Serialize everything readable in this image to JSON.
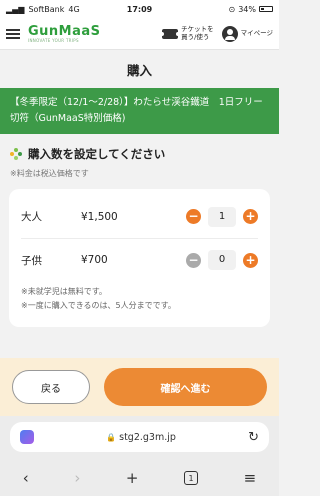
{
  "status_bar": {
    "carrier": "SoftBank",
    "network": "4G",
    "time": "17:09",
    "battery": "34%"
  },
  "header": {
    "logo_name": "GunMaaS",
    "logo_tagline": "INNOVATE YOUR TRIPS",
    "ticket_line1": "チケットを",
    "ticket_line2": "買う/使う",
    "mypage_label": "マイページ"
  },
  "page": {
    "title": "購入"
  },
  "banner": {
    "text": "【冬季限定（12/1〜2/28）】わたらせ渓谷鐵道　1日フリー切符（GunMaaS特別価格)"
  },
  "section": {
    "heading": "購入数を設定してください",
    "tax_note": "※料金は税込価格です"
  },
  "tickets": [
    {
      "label": "大人",
      "price": "¥1,500",
      "quantity": "1",
      "minus_enabled": true
    },
    {
      "label": "子供",
      "price": "¥700",
      "quantity": "0",
      "minus_enabled": false
    }
  ],
  "notes": [
    "※未就学児は無料です。",
    "※一度に購入できるのは、5人分までです。"
  ],
  "footer": {
    "back_label": "戻る",
    "confirm_label": "確認へ進む"
  },
  "browser": {
    "url": "stg2.g3m.jp",
    "tab_count": "1"
  },
  "colors": {
    "brand_green": "#3d9a48",
    "accent_orange": "#ec8a34",
    "footer_bg": "#fbeed6"
  },
  "icons": {
    "menu": "hamburger-icon",
    "ticket": "ticket-icon",
    "user": "user-icon",
    "section": "dots-icon",
    "minus": "minus-icon",
    "plus": "plus-icon",
    "lock": "lock-icon",
    "reload": "reload-icon"
  }
}
